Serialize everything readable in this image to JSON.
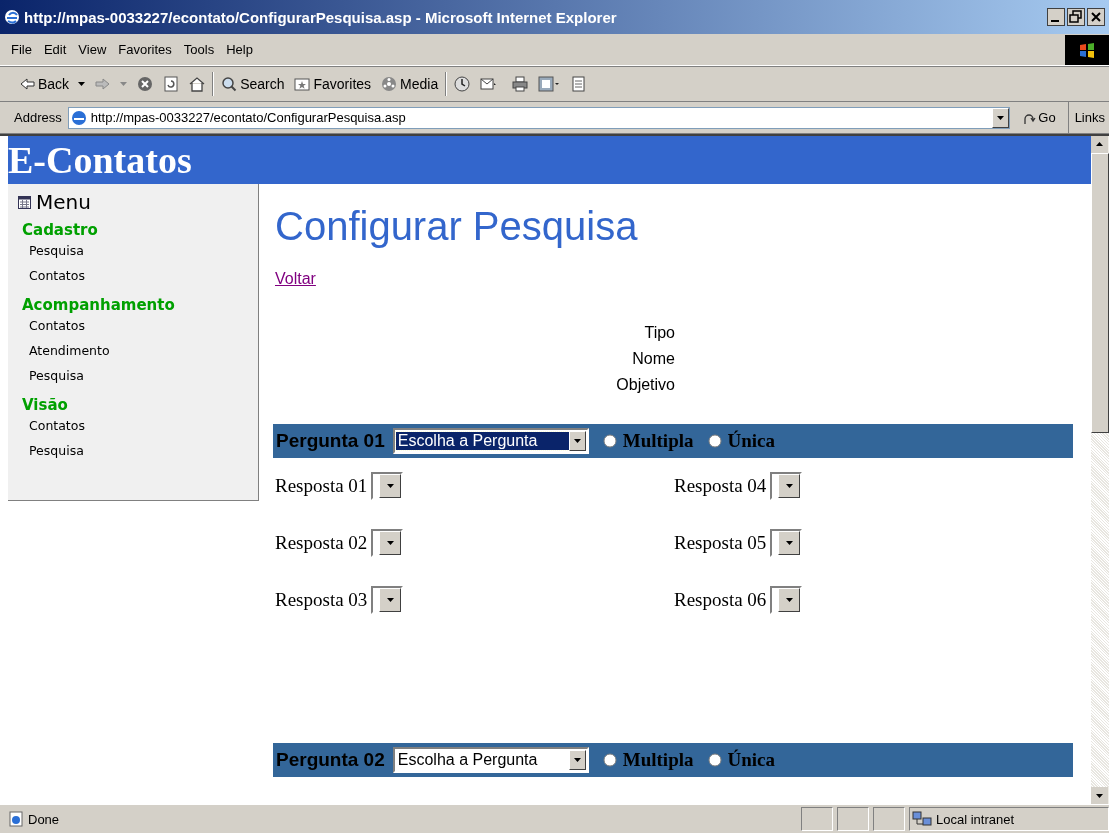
{
  "window": {
    "title": "http://mpas-0033227/econtato/ConfigurarPesquisa.asp - Microsoft Internet Explorer"
  },
  "menu_bar": [
    "File",
    "Edit",
    "View",
    "Favorites",
    "Tools",
    "Help"
  ],
  "toolbar": [
    {
      "kind": "back",
      "label": "Back"
    },
    {
      "kind": "forward"
    },
    {
      "kind": "stop"
    },
    {
      "kind": "refresh"
    },
    {
      "kind": "home"
    },
    {
      "kind": "search",
      "label": "Search"
    },
    {
      "kind": "favorites",
      "label": "Favorites"
    },
    {
      "kind": "media",
      "label": "Media"
    },
    {
      "kind": "history"
    },
    {
      "kind": "mail"
    },
    {
      "kind": "print"
    },
    {
      "kind": "edit"
    },
    {
      "kind": "discuss"
    }
  ],
  "address": {
    "label": "Address",
    "value": "http://mpas-0033227/econtato/ConfigurarPesquisa.asp",
    "go": "Go",
    "links": "Links"
  },
  "page": {
    "site_title": "E-Contatos",
    "sidebar": {
      "title": "Menu",
      "sections": [
        {
          "heading": "Cadastro",
          "items": [
            "Pesquisa",
            "Contatos"
          ]
        },
        {
          "heading": "Acompanhamento",
          "items": [
            "Contatos",
            "Atendimento",
            "Pesquisa"
          ]
        },
        {
          "heading": "Visão",
          "items": [
            "Contatos",
            "Pesquisa"
          ]
        }
      ]
    },
    "heading": "Configurar Pesquisa",
    "back_link": "Voltar",
    "fields": [
      "Tipo",
      "Nome",
      "Objetivo"
    ],
    "questions": [
      {
        "label": "Pergunta 01",
        "select": "Escolha a Pergunta",
        "focused": true,
        "options": [
          {
            "label": "Multipla",
            "selected": false
          },
          {
            "label": "Única",
            "selected": false
          }
        ],
        "answers": [
          "Resposta 01",
          "Resposta 02",
          "Resposta 03",
          "Resposta 04",
          "Resposta 05",
          "Resposta 06"
        ]
      },
      {
        "label": "Pergunta 02",
        "select": "Escolha a Pergunta",
        "focused": false,
        "options": [
          {
            "label": "Multipla",
            "selected": false
          },
          {
            "label": "Única",
            "selected": false
          }
        ]
      }
    ]
  },
  "status_bar": {
    "text": "Done",
    "zone": "Local intranet"
  }
}
